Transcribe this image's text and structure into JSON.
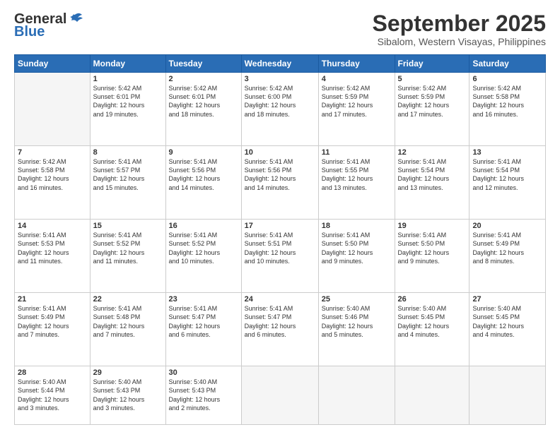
{
  "header": {
    "logo_text_general": "General",
    "logo_text_blue": "Blue",
    "calendar_title": "September 2025",
    "calendar_subtitle": "Sibalom, Western Visayas, Philippines"
  },
  "weekdays": [
    "Sunday",
    "Monday",
    "Tuesday",
    "Wednesday",
    "Thursday",
    "Friday",
    "Saturday"
  ],
  "weeks": [
    [
      {
        "day": "",
        "empty": true
      },
      {
        "day": "1",
        "sunrise": "5:42 AM",
        "sunset": "6:01 PM",
        "daylight": "12 hours and 19 minutes."
      },
      {
        "day": "2",
        "sunrise": "5:42 AM",
        "sunset": "6:01 PM",
        "daylight": "12 hours and 18 minutes."
      },
      {
        "day": "3",
        "sunrise": "5:42 AM",
        "sunset": "6:00 PM",
        "daylight": "12 hours and 18 minutes."
      },
      {
        "day": "4",
        "sunrise": "5:42 AM",
        "sunset": "5:59 PM",
        "daylight": "12 hours and 17 minutes."
      },
      {
        "day": "5",
        "sunrise": "5:42 AM",
        "sunset": "5:59 PM",
        "daylight": "12 hours and 17 minutes."
      },
      {
        "day": "6",
        "sunrise": "5:42 AM",
        "sunset": "5:58 PM",
        "daylight": "12 hours and 16 minutes."
      }
    ],
    [
      {
        "day": "7",
        "sunrise": "5:42 AM",
        "sunset": "5:58 PM",
        "daylight": "12 hours and 16 minutes."
      },
      {
        "day": "8",
        "sunrise": "5:41 AM",
        "sunset": "5:57 PM",
        "daylight": "12 hours and 15 minutes."
      },
      {
        "day": "9",
        "sunrise": "5:41 AM",
        "sunset": "5:56 PM",
        "daylight": "12 hours and 14 minutes."
      },
      {
        "day": "10",
        "sunrise": "5:41 AM",
        "sunset": "5:56 PM",
        "daylight": "12 hours and 14 minutes."
      },
      {
        "day": "11",
        "sunrise": "5:41 AM",
        "sunset": "5:55 PM",
        "daylight": "12 hours and 13 minutes."
      },
      {
        "day": "12",
        "sunrise": "5:41 AM",
        "sunset": "5:54 PM",
        "daylight": "12 hours and 13 minutes."
      },
      {
        "day": "13",
        "sunrise": "5:41 AM",
        "sunset": "5:54 PM",
        "daylight": "12 hours and 12 minutes."
      }
    ],
    [
      {
        "day": "14",
        "sunrise": "5:41 AM",
        "sunset": "5:53 PM",
        "daylight": "12 hours and 11 minutes."
      },
      {
        "day": "15",
        "sunrise": "5:41 AM",
        "sunset": "5:52 PM",
        "daylight": "12 hours and 11 minutes."
      },
      {
        "day": "16",
        "sunrise": "5:41 AM",
        "sunset": "5:52 PM",
        "daylight": "12 hours and 10 minutes."
      },
      {
        "day": "17",
        "sunrise": "5:41 AM",
        "sunset": "5:51 PM",
        "daylight": "12 hours and 10 minutes."
      },
      {
        "day": "18",
        "sunrise": "5:41 AM",
        "sunset": "5:50 PM",
        "daylight": "12 hours and 9 minutes."
      },
      {
        "day": "19",
        "sunrise": "5:41 AM",
        "sunset": "5:50 PM",
        "daylight": "12 hours and 9 minutes."
      },
      {
        "day": "20",
        "sunrise": "5:41 AM",
        "sunset": "5:49 PM",
        "daylight": "12 hours and 8 minutes."
      }
    ],
    [
      {
        "day": "21",
        "sunrise": "5:41 AM",
        "sunset": "5:49 PM",
        "daylight": "12 hours and 7 minutes."
      },
      {
        "day": "22",
        "sunrise": "5:41 AM",
        "sunset": "5:48 PM",
        "daylight": "12 hours and 7 minutes."
      },
      {
        "day": "23",
        "sunrise": "5:41 AM",
        "sunset": "5:47 PM",
        "daylight": "12 hours and 6 minutes."
      },
      {
        "day": "24",
        "sunrise": "5:41 AM",
        "sunset": "5:47 PM",
        "daylight": "12 hours and 6 minutes."
      },
      {
        "day": "25",
        "sunrise": "5:40 AM",
        "sunset": "5:46 PM",
        "daylight": "12 hours and 5 minutes."
      },
      {
        "day": "26",
        "sunrise": "5:40 AM",
        "sunset": "5:45 PM",
        "daylight": "12 hours and 4 minutes."
      },
      {
        "day": "27",
        "sunrise": "5:40 AM",
        "sunset": "5:45 PM",
        "daylight": "12 hours and 4 minutes."
      }
    ],
    [
      {
        "day": "28",
        "sunrise": "5:40 AM",
        "sunset": "5:44 PM",
        "daylight": "12 hours and 3 minutes."
      },
      {
        "day": "29",
        "sunrise": "5:40 AM",
        "sunset": "5:43 PM",
        "daylight": "12 hours and 3 minutes."
      },
      {
        "day": "30",
        "sunrise": "5:40 AM",
        "sunset": "5:43 PM",
        "daylight": "12 hours and 2 minutes."
      },
      {
        "day": "",
        "empty": true
      },
      {
        "day": "",
        "empty": true
      },
      {
        "day": "",
        "empty": true
      },
      {
        "day": "",
        "empty": true
      }
    ]
  ]
}
